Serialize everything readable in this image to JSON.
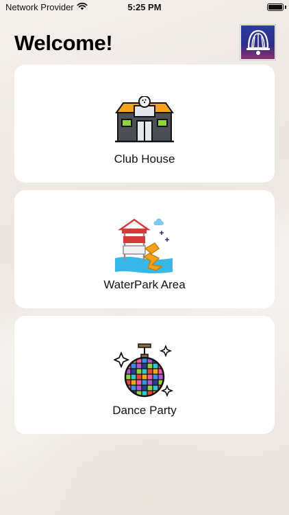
{
  "status_bar": {
    "carrier": "Network Provider",
    "time": "5:25 PM",
    "battery_level": 1.0
  },
  "header": {
    "title": "Welcome!"
  },
  "cards": [
    {
      "label": "Club House",
      "icon": "club-house-icon"
    },
    {
      "label": "WaterPark Area",
      "icon": "waterpark-icon"
    },
    {
      "label": "Dance Party",
      "icon": "disco-ball-icon"
    }
  ]
}
